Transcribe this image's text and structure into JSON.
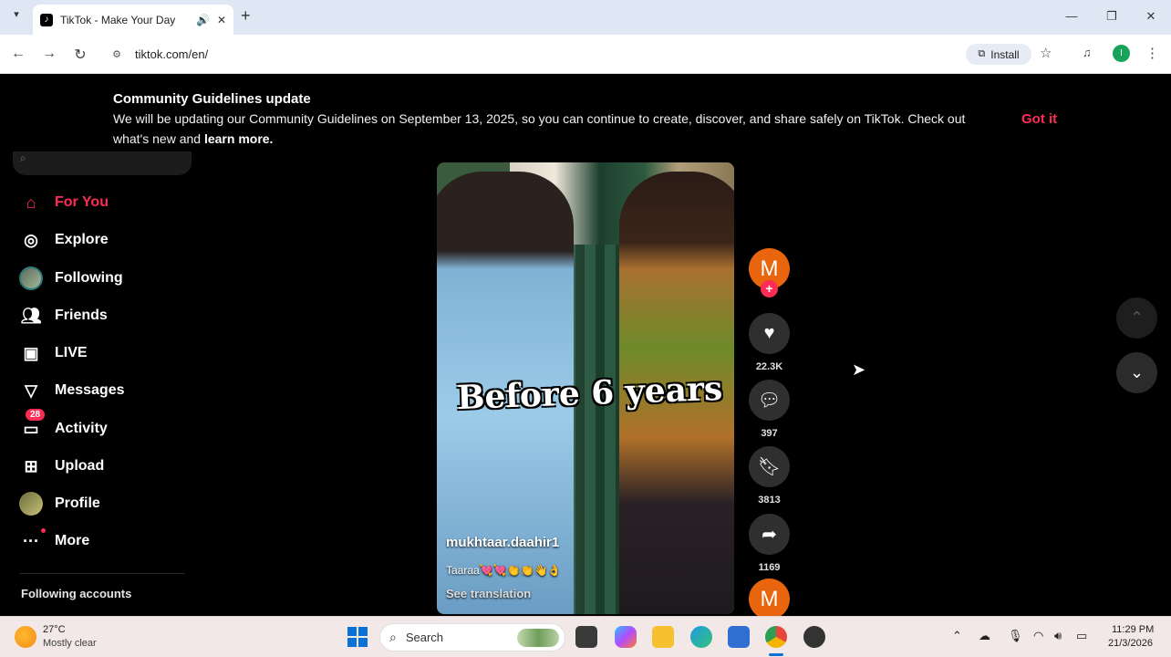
{
  "browser": {
    "tab_title": "TikTok - Make Your Day",
    "url": "tiktok.com/en/",
    "install_label": "Install",
    "profile_initial": "I"
  },
  "banner": {
    "heading": "Community Guidelines update",
    "text_line1": "We will be updating our Community Guidelines on September 13, 2025, so you can continue to create, discover, and share safely on TikTok. Check out",
    "text_line2_prefix": "what's new and ",
    "text_link": "learn more.",
    "got_it": "Got it"
  },
  "sidebar": {
    "items": [
      {
        "label": "For You",
        "icon": "home-icon"
      },
      {
        "label": "Explore",
        "icon": "compass-icon"
      },
      {
        "label": "Following",
        "icon": "following-avatar-icon"
      },
      {
        "label": "Friends",
        "icon": "friends-icon"
      },
      {
        "label": "LIVE",
        "icon": "live-icon"
      },
      {
        "label": "Messages",
        "icon": "messages-icon"
      },
      {
        "label": "Activity",
        "icon": "activity-icon",
        "badge": "28"
      },
      {
        "label": "Upload",
        "icon": "upload-icon"
      },
      {
        "label": "Profile",
        "icon": "profile-avatar-icon"
      },
      {
        "label": "More",
        "icon": "more-icon"
      }
    ],
    "following_accounts": "Following accounts"
  },
  "video": {
    "overlay_text": "Before 6 years",
    "username": "mukhtaar.daahir1",
    "description": "Taaraa💘💘👏👏👋👌",
    "see_translation": "See translation"
  },
  "actions": {
    "creator_initial": "M",
    "likes": "22.3K",
    "comments": "397",
    "saves": "3813",
    "shares": "1169"
  },
  "taskbar": {
    "temperature": "27°C",
    "weather": "Mostly clear",
    "search_placeholder": "Search",
    "time": "11:29 PM",
    "date": "21/3/2026"
  },
  "colors": {
    "accent": "#fe2c55",
    "creator_avatar": "#e8650e"
  }
}
